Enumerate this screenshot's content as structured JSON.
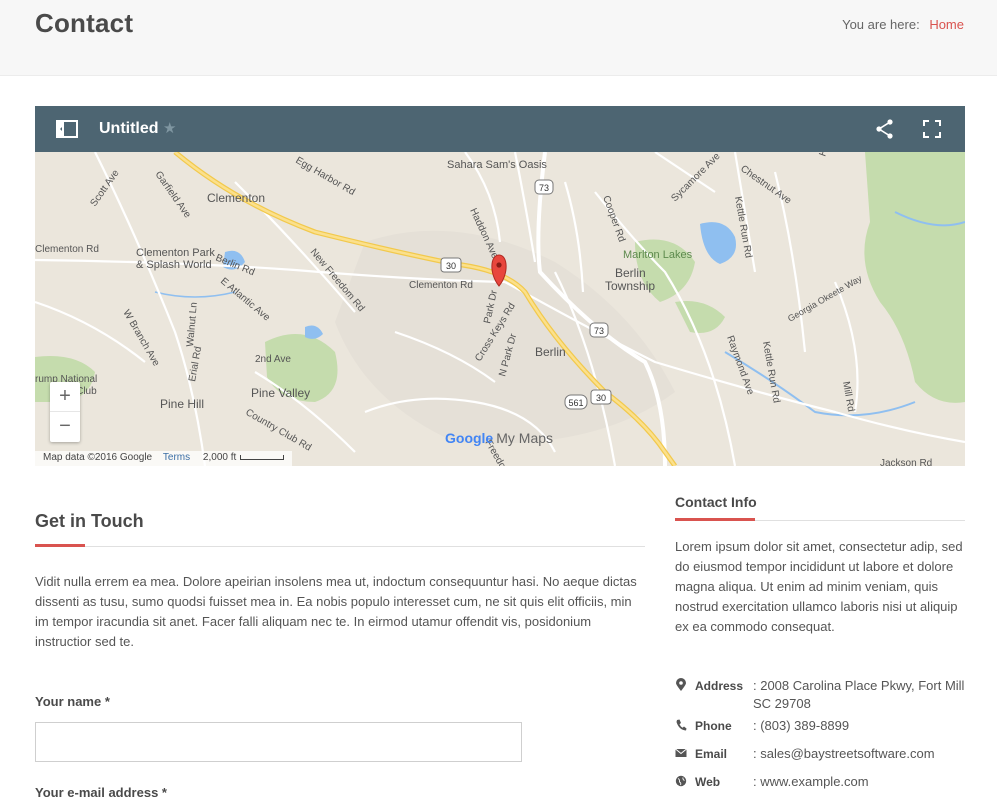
{
  "page": {
    "title": "Contact",
    "breadcrumb": {
      "prefix": "You are here:",
      "items": [
        "Home"
      ]
    }
  },
  "map": {
    "title": "Untitled",
    "zoom_in": "+",
    "zoom_out": "−",
    "attribution": "Map data ©2016 Google",
    "terms": "Terms",
    "scale": "2,000 ft",
    "branding": {
      "google": "Google",
      "product": "My Maps"
    },
    "labels": {
      "clementon": "Clementon",
      "clementon_park": "Clementon Park",
      "splash_world": "& Splash World",
      "pine_hill": "Pine Hill",
      "pine_valley": "Pine Valley",
      "berlin": "Berlin",
      "berlin_township_1": "Berlin",
      "berlin_township_2": "Township",
      "marlton_lakes": "Marlton Lakes",
      "sahara": "Sahara Sam's Oasis",
      "egg_harbor": "Egg Harbor Rd",
      "scott_ave": "Scott Ave",
      "garfield_ave": "Garfield Ave",
      "clementon_rd_w": "Clementon Rd",
      "clementon_rd": "Clementon Rd",
      "berlin_rd": "Berlin Rd",
      "new_freedom": "New Freedom Rd",
      "e_atlantic": "E Atlantic Ave",
      "erial_rd": "Erial Rd",
      "walnut_ln": "Walnut Ln",
      "w_branch": "W Branch Ave",
      "second_ave": "2nd Ave",
      "country_club": "Country Club Rd",
      "trump_national_1": "rump National",
      "trump_national_2": "Golf Club",
      "haddon_ave": "Haddon Ave",
      "park_dr": "Park Dr",
      "n_park_dr": "N Park Dr",
      "cross_keys": "Cross Keys Rd",
      "cooper_rd": "Cooper Rd",
      "sycamore": "Sycamore Ave",
      "chestnut": "Chestnut Ave",
      "kettle_run_1": "Kettle Run Rd",
      "kettle_run_2": "Kettle Run Rd",
      "georgia": "Georgia Okeete Way",
      "raymond": "Raymond Ave",
      "mill_rd": "Mill Rd",
      "jackson_rd": "Jackson Rd",
      "freedom": "Freedo",
      "ho": "Ho",
      "shield_73a": "73",
      "shield_73b": "73",
      "shield_30a": "30",
      "shield_30b": "30",
      "shield_561": "561"
    }
  },
  "contact_form": {
    "heading": "Get in Touch",
    "intro": "Vidit nulla errem ea mea. Dolore apeirian insolens mea ut, indoctum consequuntur hasi. No aeque dictas dissenti as tusu, sumo quodsi fuisset mea in. Ea nobis populo interesset cum, ne sit quis elit officiis, min im tempor iracundia sit anet. Facer falli aliquam nec te. In eirmod utamur offendit vis, posidonium instructior sed te.",
    "name_label": "Your name *",
    "name_value": "",
    "email_label": "Your e-mail address *"
  },
  "contact_info": {
    "heading": "Contact Info",
    "text": "Lorem ipsum dolor sit amet, consectetur adip, sed do eiusmod tempor incididunt ut labore et dolore magna aliqua. Ut enim ad minim veniam, quis nostrud exercitation ullamco laboris nisi ut aliquip ex ea commodo consequat.",
    "rows": [
      {
        "icon": "map-marker-icon",
        "label": "Address",
        "value": ": 2008 Carolina Place Pkwy, Fort Mill SC 29708"
      },
      {
        "icon": "phone-icon",
        "label": "Phone",
        "value": ": (803) 389-8899"
      },
      {
        "icon": "envelope-icon",
        "label": "Email",
        "value": ": sales@baystreetsoftware.com"
      },
      {
        "icon": "globe-icon",
        "label": "Web",
        "value": ": www.example.com"
      }
    ]
  },
  "colors": {
    "accent": "#d9534f",
    "toolbar": "#4d6572",
    "map_land": "#ebe6dc",
    "highway": "#f6cf5c",
    "water": "#8fbff0",
    "park": "#b9d7a1"
  }
}
